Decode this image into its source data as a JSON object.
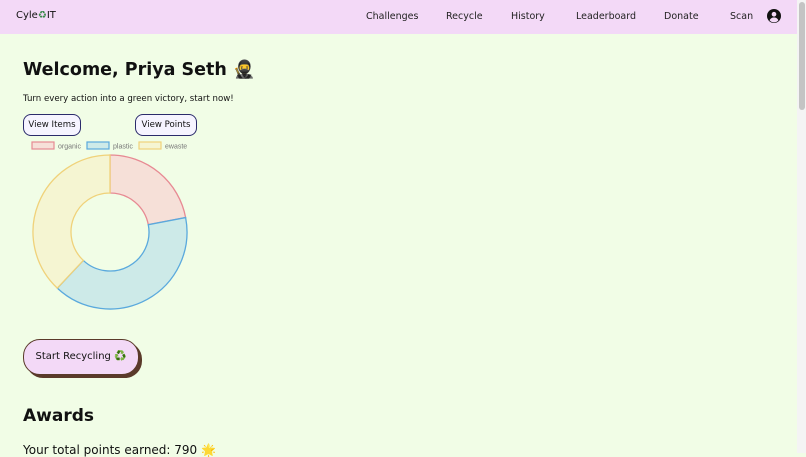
{
  "brand": {
    "name_pre": "Cyle",
    "recycle_symbol": "♻",
    "name_post": "IT"
  },
  "nav": {
    "items": [
      "Challenges",
      "Recycle",
      "History",
      "Leaderboard",
      "Donate",
      "Scan"
    ],
    "avatar_icon": "account-circle-icon"
  },
  "main": {
    "welcome": "Welcome, Priya Seth",
    "welcome_emoji": "🥷",
    "tagline": "Turn every action into a green victory, start now!",
    "view_items_label": "View Items",
    "view_points_label": "View Points",
    "start_recycling_label": "Start Recycling",
    "start_recycling_emoji": "♻️",
    "awards_heading": "Awards",
    "points_text": "Your total points earned: 790",
    "points_emoji": "🌟"
  },
  "chart_data": {
    "type": "doughnut",
    "legend_position": "top",
    "series": [
      {
        "label": "organic",
        "value": 22,
        "fill": "#f6e0d8",
        "stroke": "#e78a93"
      },
      {
        "label": "plastic",
        "value": 40,
        "fill": "#cdeae8",
        "stroke": "#5aa9dd"
      },
      {
        "label": "ewaste",
        "value": 38,
        "fill": "#f5f5d2",
        "stroke": "#f0d27a"
      }
    ]
  },
  "colors": {
    "page_bg": "#f1fde6",
    "navbar_bg": "#f3d9f7",
    "button_border": "#2b2b6b"
  }
}
